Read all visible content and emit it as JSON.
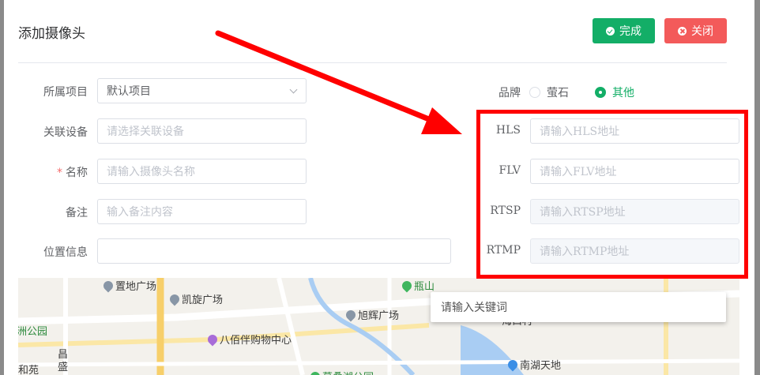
{
  "dialog": {
    "title": "添加摄像头",
    "done_label": "完成",
    "close_label": "关闭"
  },
  "form": {
    "project": {
      "label": "所属项目",
      "value": "默认项目"
    },
    "device": {
      "label": "关联设备",
      "placeholder": "请选择关联设备"
    },
    "name": {
      "required_mark": "*",
      "label": "名称",
      "placeholder": "请输入摄像头名称"
    },
    "remark": {
      "label": "备注",
      "placeholder": "输入备注内容"
    },
    "location": {
      "label": "位置信息",
      "value": ""
    },
    "brand": {
      "label": "品牌",
      "options": [
        {
          "label": "萤石",
          "checked": false
        },
        {
          "label": "其他",
          "checked": true
        }
      ]
    },
    "hls": {
      "label": "HLS",
      "placeholder": "请输入HLS地址"
    },
    "flv": {
      "label": "FLV",
      "placeholder": "请输入FLV地址"
    },
    "rtsp": {
      "label": "RTSP",
      "placeholder": "请输入RTSP地址",
      "disabled": true
    },
    "rtmp": {
      "label": "RTMP",
      "placeholder": "请输入RTMP地址",
      "disabled": true
    }
  },
  "map": {
    "search_placeholder": "请输入关键词",
    "pois": {
      "p1": "置地广场",
      "p2": "凯旋广场",
      "p3": "八佰伴购物中心",
      "p4": "旭辉广场",
      "p5": "瓶山",
      "p6": "南湖天地",
      "p7": "洲公园",
      "p8": "昌",
      "p9": "盛",
      "p10": "和苑",
      "p11": "葛叠湖公园",
      "p12": "海口村"
    }
  },
  "colors": {
    "primary": "#13ae67",
    "danger": "#f35a5a",
    "highlight": "#ff0000"
  }
}
